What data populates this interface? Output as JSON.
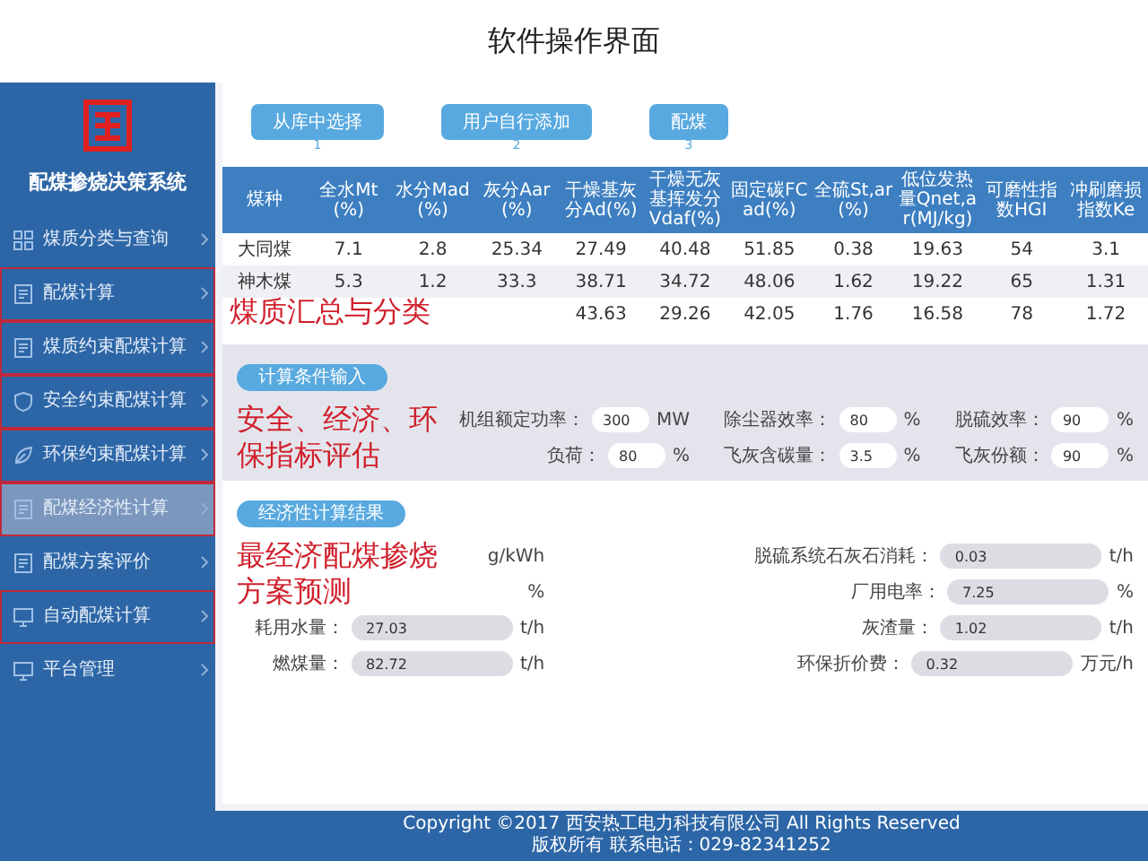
{
  "slide_title": "软件操作界面",
  "app": {
    "name": "配煤掺烧决策系统"
  },
  "sidebar": {
    "items": [
      {
        "label": "煤质分类与查询",
        "selected": false,
        "highlighted": false
      },
      {
        "label": "配煤计算",
        "selected": false,
        "highlighted": true
      },
      {
        "label": "煤质约束配煤计算",
        "selected": false,
        "highlighted": true
      },
      {
        "label": "安全约束配煤计算",
        "selected": false,
        "highlighted": true
      },
      {
        "label": "环保约束配煤计算",
        "selected": false,
        "highlighted": true
      },
      {
        "label": "配煤经济性计算",
        "selected": true,
        "highlighted": true
      },
      {
        "label": "配煤方案评价",
        "selected": false,
        "highlighted": false
      },
      {
        "label": "自动配煤计算",
        "selected": false,
        "highlighted": true
      },
      {
        "label": "平台管理",
        "selected": false,
        "highlighted": false
      }
    ]
  },
  "steps": [
    {
      "label": "从库中选择",
      "number": "1"
    },
    {
      "label": "用户自行添加",
      "number": "2"
    },
    {
      "label": "配煤",
      "number": "3"
    }
  ],
  "table": {
    "columns": [
      "煤种",
      "全水Mt(%)",
      "水分Mad(%)",
      "灰分Aar(%)",
      "干燥基灰分Ad(%)",
      "干燥无灰基挥发分Vdaf(%)",
      "固定碳FCad(%)",
      "全硫St,ar(%)",
      "低位发热量Qnet,ar(MJ/kg)",
      "可磨性指数HGI",
      "冲刷磨损指数Ke"
    ],
    "rows": [
      [
        "大同煤",
        "7.1",
        "2.8",
        "25.34",
        "27.49",
        "40.48",
        "51.85",
        "0.38",
        "19.63",
        "54",
        "3.1"
      ],
      [
        "神木煤",
        "5.3",
        "1.2",
        "33.3",
        "38.71",
        "34.72",
        "48.06",
        "1.62",
        "19.22",
        "65",
        "1.31"
      ],
      [
        "",
        "",
        "",
        "",
        "43.63",
        "29.26",
        "42.05",
        "1.76",
        "16.58",
        "78",
        "1.72"
      ]
    ]
  },
  "input_section": {
    "title": "计算条件输入",
    "fields": [
      {
        "label": "机组额定功率：",
        "value": "300",
        "unit": "MW"
      },
      {
        "label": "除尘器效率：",
        "value": "80",
        "unit": "%"
      },
      {
        "label": "脱硫效率：",
        "value": "90",
        "unit": "%"
      },
      {
        "label": "负荷：",
        "value": "80",
        "unit": "%"
      },
      {
        "label": "飞灰含碳量：",
        "value": "3.5",
        "unit": "%"
      },
      {
        "label": "飞灰份额：",
        "value": "90",
        "unit": "%"
      }
    ]
  },
  "result_section": {
    "title": "经济性计算结果",
    "left": [
      {
        "unit": "g/kWh"
      },
      {
        "unit": "%"
      },
      {
        "label": "耗用水量：",
        "value": "27.03",
        "unit": "t/h"
      },
      {
        "label": "燃煤量：",
        "value": "82.72",
        "unit": "t/h"
      }
    ],
    "right": [
      {
        "label": "脱硫系统石灰石消耗：",
        "value": "0.03",
        "unit": "t/h"
      },
      {
        "label": "厂用电率：",
        "value": "7.25",
        "unit": "%"
      },
      {
        "label": "灰渣量：",
        "value": "1.02",
        "unit": "t/h"
      },
      {
        "label": "环保折价费：",
        "value": "0.32",
        "unit": "万元/h"
      }
    ]
  },
  "footer": {
    "lines": [
      "Copyright ©2017 西安热工电力科技有限公司 All Rights Reserved",
      "版权所有 联系电话：029-82341252"
    ]
  },
  "annotations": [
    "煤质汇总与分类",
    "安全、经济、环保指标评估",
    "最经济配煤掺烧方案预测"
  ]
}
